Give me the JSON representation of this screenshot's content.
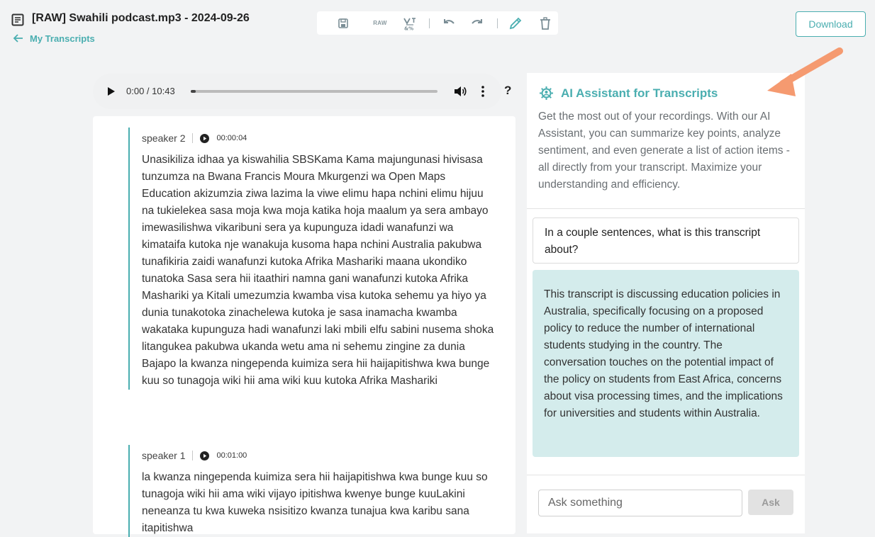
{
  "header": {
    "title": "[RAW] Swahili podcast.mp3 - 2024-09-26",
    "back_label": "My Transcripts",
    "download_label": "Download"
  },
  "toolbar": {
    "raw_label": "RAW",
    "icons": [
      "save-icon",
      "raw-icon",
      "translate-icon",
      "undo-icon",
      "redo-icon",
      "edit-icon",
      "delete-icon"
    ]
  },
  "audio": {
    "time": "0:00 / 10:43",
    "progress_fraction": 0.02
  },
  "help_label": "?",
  "transcript": {
    "segments": [
      {
        "speaker": "speaker 2",
        "timestamp": "00:00:04",
        "text": "Unasikiliza idhaa ya kiswahilia SBSKama Kama majungunasi hivisasa tunzumza na Bwana Francis Moura Mkurgenzi wa Open Maps Education akizumzia ziwa lazima la viwe elimu hapa nchini elimu hijuu na tukielekea sasa moja kwa moja katika hoja maalum ya sera ambayo imewasilishwa vikaribuni sera ya kupunguza idadi wanafunzi wa kimataifa kutoka nje wanakuja kusoma hapa nchini Australia pakubwa tunafikiria zaidi wanafunzi kutoka Afrika Mashariki maana ukondiko tunatoka Sasa sera hii itaathiri namna gani wanafunzi kutoka Afrika Mashariki ya Kitali umezumzia kwamba visa kutoka sehemu ya hiyo ya dunia tunakotoka zinachelewa kutoka je sasa inamacha kwamba wakataka kupunguza hadi wanafunzi laki mbili elfu sabini nusema shoka litangukea pakubwa ukanda wetu ama ni sehemu zingine za dunia Bajapo la kwanza ningependa kuimiza sera hii haijapitishwa kwa bunge kuu so tunagoja wiki hii ama wiki kuu kutoka Afrika Mashariki"
      },
      {
        "speaker": "speaker 1",
        "timestamp": "00:01:00",
        "text": "la kwanza ningependa kuimiza sera hii haijapitishwa kwa bunge kuu so tunagoja wiki hii ama wiki vijayo ipitishwa kwenye bunge kuuLakini neneanza tu kwa kuweka nsisitizo kwanza tunajua kwa karibu sana itapitishwa"
      }
    ]
  },
  "ai": {
    "title": "AI Assistant for Transcripts",
    "description": "Get the most out of your recordings. With our AI Assistant, you can summarize key points, analyze sentiment, and even generate a list of action items - all directly from your transcript. Maximize your understanding and efficiency.",
    "question": "In a couple sentences, what is this transcript about?",
    "answer": "This transcript is discussing education policies in Australia, specifically focusing on a proposed policy to reduce the number of international students studying in the country. The conversation touches on the potential impact of the policy on students from East Africa, concerns about visa processing times, and the implications for universities and students within Australia.",
    "input_placeholder": "Ask something",
    "ask_label": "Ask"
  },
  "colors": {
    "accent": "#4aaeb0",
    "answer_bg": "#d4ecec",
    "arrow": "#f59a70"
  }
}
